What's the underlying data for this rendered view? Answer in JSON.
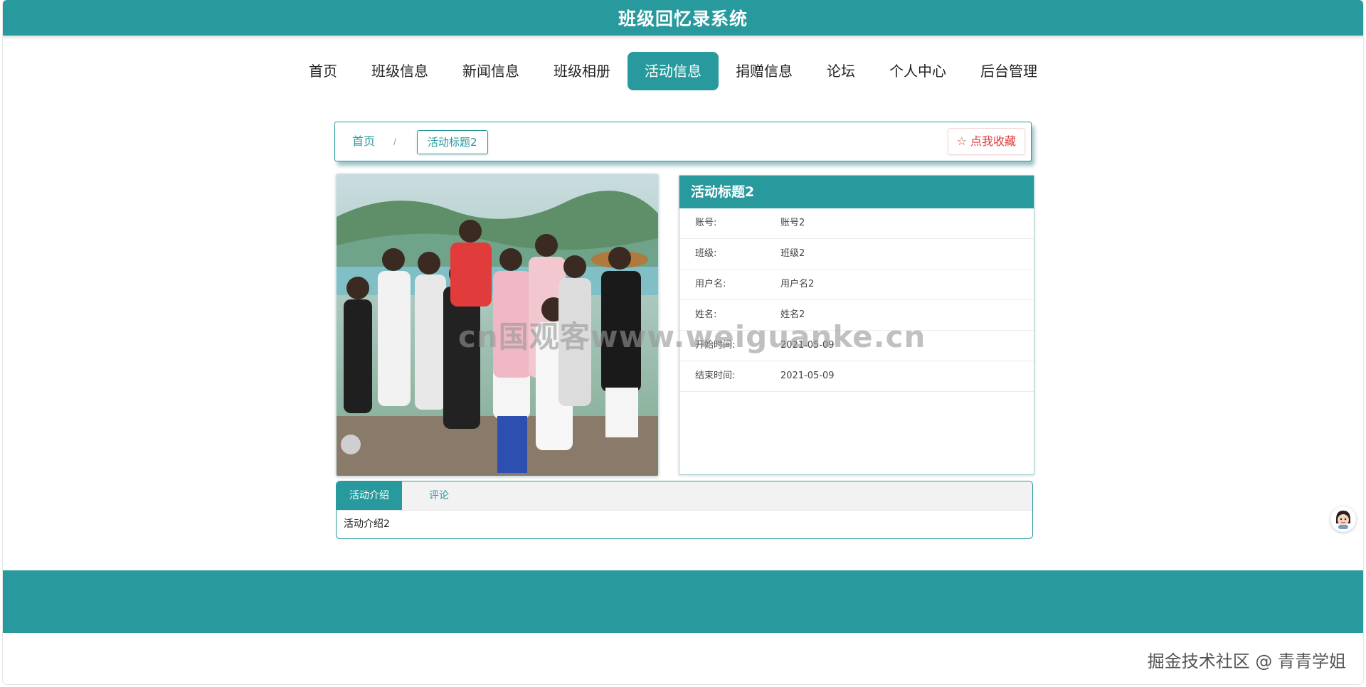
{
  "header": {
    "title": "班级回忆录系统"
  },
  "nav": {
    "items": [
      {
        "label": "首页",
        "active": false
      },
      {
        "label": "班级信息",
        "active": false
      },
      {
        "label": "新闻信息",
        "active": false
      },
      {
        "label": "班级相册",
        "active": false
      },
      {
        "label": "活动信息",
        "active": true
      },
      {
        "label": "捐赠信息",
        "active": false
      },
      {
        "label": "论坛",
        "active": false
      },
      {
        "label": "个人中心",
        "active": false
      },
      {
        "label": "后台管理",
        "active": false
      }
    ]
  },
  "breadcrumb": {
    "home": "首页",
    "separator": "/",
    "current": "活动标题2",
    "favorite_label": "☆ 点我收藏"
  },
  "detail": {
    "title": "活动标题2",
    "rows": [
      {
        "label": "账号:",
        "value": "账号2"
      },
      {
        "label": "班级:",
        "value": "班级2"
      },
      {
        "label": "用户名:",
        "value": "用户名2"
      },
      {
        "label": "姓名:",
        "value": "姓名2"
      },
      {
        "label": "开始时间:",
        "value": "2021-05-09"
      },
      {
        "label": "结束时间:",
        "value": "2021-05-09"
      }
    ]
  },
  "tabs": {
    "items": [
      {
        "label": "活动介绍",
        "active": true
      },
      {
        "label": "评论",
        "active": false
      }
    ],
    "content": "活动介绍2"
  },
  "watermarks": {
    "center": "cn国观客www.weiguanke.cn",
    "bottom": "掘金技术社区 @ 青青学姐"
  },
  "colors": {
    "primary": "#289a9d",
    "favorite": "#e23b3b"
  }
}
